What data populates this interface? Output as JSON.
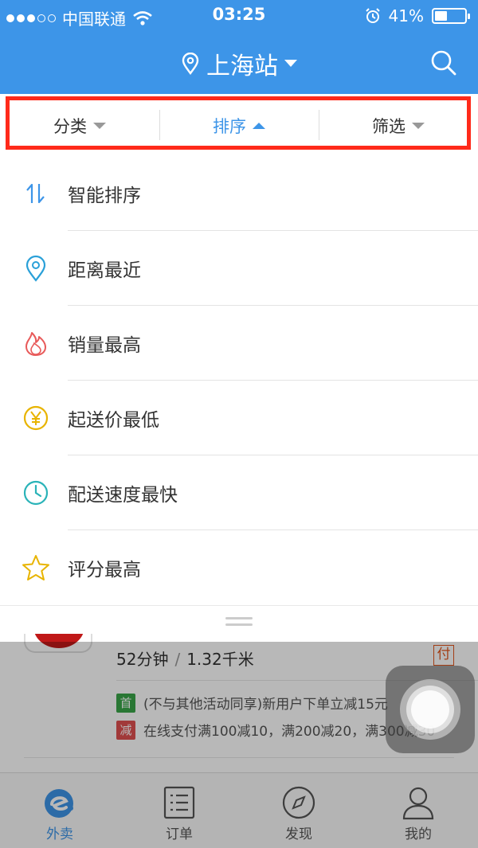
{
  "status_bar": {
    "carrier": "中国联通",
    "time": "03:25",
    "battery": "41%",
    "battery_level": 0.41
  },
  "header": {
    "location": "上海站",
    "search_icon": "search-icon",
    "accent_color": "#3d95e8"
  },
  "filter_tabs": [
    {
      "label": "分类",
      "state": "collapsed"
    },
    {
      "label": "排序",
      "state": "expanded"
    },
    {
      "label": "筛选",
      "state": "collapsed"
    }
  ],
  "sort_options": [
    {
      "label": "智能排序",
      "icon": "sort-arrows-icon",
      "color": "#3d95e8"
    },
    {
      "label": "距离最近",
      "icon": "location-pin-icon",
      "color": "#2aa0d8"
    },
    {
      "label": "销量最高",
      "icon": "flame-icon",
      "color": "#e85a5a"
    },
    {
      "label": "起送价最低",
      "icon": "yen-coin-icon",
      "color": "#e8b400"
    },
    {
      "label": "配送速度最快",
      "icon": "clock-icon",
      "color": "#2ab3b8"
    },
    {
      "label": "评分最高",
      "icon": "star-icon",
      "color": "#e8b400"
    }
  ],
  "shop": {
    "time": "52分钟",
    "distance": "1.32千米",
    "pay_badge": "付",
    "promotions": [
      {
        "badge": "首",
        "badge_color": "#3aa548",
        "text": "(不与其他活动同享)新用户下单立减15元"
      },
      {
        "badge": "减",
        "badge_color": "#e05050",
        "text": "在线支付满100减10，满200减20，满300减30"
      }
    ]
  },
  "tab_bar": [
    {
      "label": "外卖",
      "icon": "eleme-logo-icon",
      "active": true
    },
    {
      "label": "订单",
      "icon": "order-list-icon",
      "active": false
    },
    {
      "label": "发现",
      "icon": "compass-icon",
      "active": false
    },
    {
      "label": "我的",
      "icon": "profile-icon",
      "active": false
    }
  ]
}
